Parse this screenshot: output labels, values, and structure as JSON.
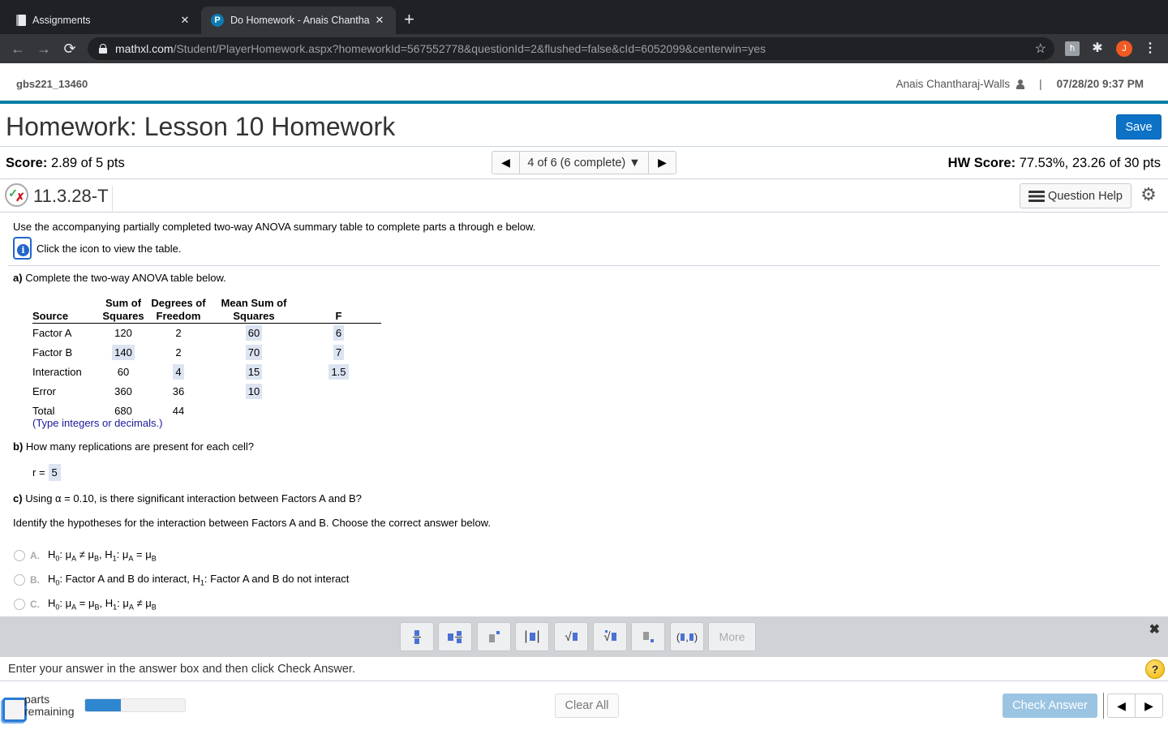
{
  "browser": {
    "tabs": [
      {
        "title": "Assignments",
        "active": false,
        "icon": "book-icon"
      },
      {
        "title": "Do Homework - Anais Chantha",
        "active": true,
        "icon": "pearson-p-icon"
      }
    ],
    "new_tab_symbol": "+",
    "close_symbol": "✕",
    "url_host": "mathxl.com",
    "url_path": "/Student/PlayerHomework.aspx?homeworkId=567552778&questionId=2&flushed=false&cId=6052099&centerwin=yes",
    "profile_initial": "J",
    "extension_label": "ћ"
  },
  "header": {
    "course_id": "gbs221_13460",
    "user_name": "Anais Chantharaj-Walls",
    "separator": "|",
    "datetime": "07/28/20 9:37 PM"
  },
  "homework": {
    "title": "Homework: Lesson 10 Homework",
    "save_label": "Save",
    "score_label": "Score:",
    "score_value": "2.89 of 5 pts",
    "question_selector": "4 of 6 (6 complete)",
    "hw_score_label": "HW Score:",
    "hw_score_value": "77.53%, 23.26 of 30 pts"
  },
  "question": {
    "id": "11.3.28-T",
    "help_label": "Question Help",
    "intro": "Use the accompanying partially completed two-way ANOVA summary table to complete parts a through e below.",
    "info_text": "Click the icon to view the table.",
    "part_a_label": "a)",
    "part_a_text": "Complete the two-way ANOVA table below.",
    "table": {
      "headers": {
        "source": "Source",
        "ss_top": "Sum of",
        "ss_bottom": "Squares",
        "df_top": "Degrees of",
        "df_bottom": "Freedom",
        "ms_top": "Mean Sum of",
        "ms_bottom": "Squares",
        "f": "F"
      },
      "rows": [
        {
          "source": "Factor A",
          "ss": "120",
          "df": "2",
          "ms": "60",
          "f": "6"
        },
        {
          "source": "Factor B",
          "ss": "140",
          "df": "2",
          "ms": "70",
          "f": "7"
        },
        {
          "source": "Interaction",
          "ss": "60",
          "df": "4",
          "ms": "15",
          "f": "1.5"
        },
        {
          "source": "Error",
          "ss": "360",
          "df": "36",
          "ms": "10",
          "f": ""
        },
        {
          "source": "Total",
          "ss": "680",
          "df": "44",
          "ms": "",
          "f": ""
        }
      ]
    },
    "type_note": "(Type integers or decimals.)",
    "part_b_label": "b)",
    "part_b_text": "How many replications are present for each cell?",
    "r_label": "r =",
    "r_value": "5",
    "part_c_label": "c)",
    "part_c_text": "Using α = 0.10, is there significant interaction between Factors A and B?",
    "identify_text": "Identify the hypotheses for the interaction between Factors A and B. Choose the correct answer below.",
    "options": [
      {
        "letter": "A.",
        "h0": "μ_A ≠ μ_B",
        "h1": "μ_A = μ_B"
      },
      {
        "letter": "B.",
        "h0": "Factor A and B do interact",
        "h1": "Factor A and B do not interact"
      },
      {
        "letter": "C.",
        "h0": "μ_A = μ_B",
        "h1": "μ_A ≠ μ_B"
      }
    ]
  },
  "palette": {
    "buttons": [
      "fraction",
      "mixed-number",
      "exponent",
      "absolute-value",
      "square-root",
      "nth-root",
      "subscript",
      "ordered-pair"
    ],
    "more_label": "More",
    "close_symbol": "✖"
  },
  "status": {
    "text": "Enter your answer in the answer box and then click Check Answer.",
    "help_symbol": "?"
  },
  "footer": {
    "parts_line1": "parts",
    "parts_line2": "remaining",
    "progress_fraction": 0.36,
    "clear_label": "Clear All",
    "check_label": "Check Answer"
  }
}
